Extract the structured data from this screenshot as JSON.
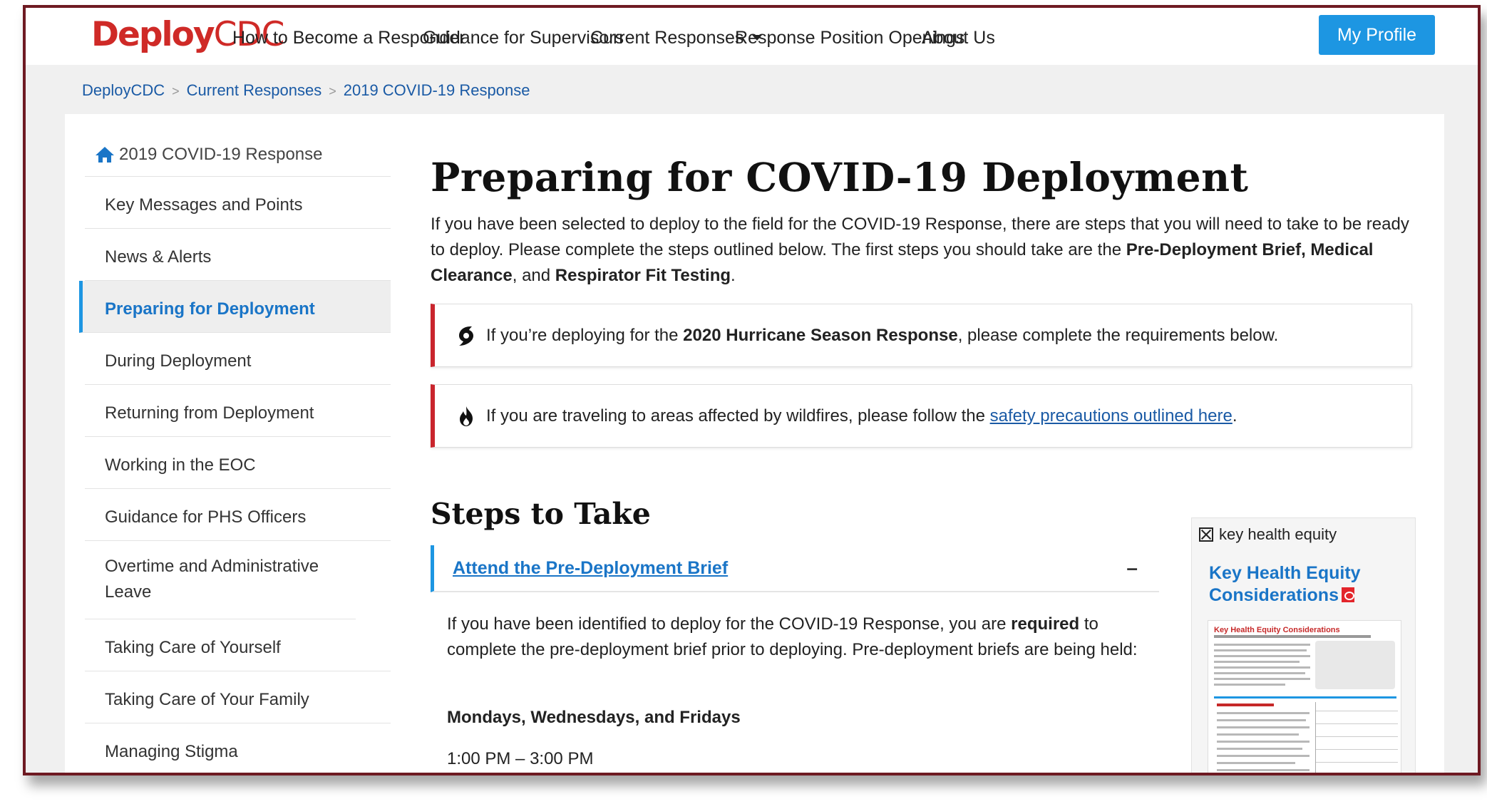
{
  "nav": {
    "logo_prefix": "Deploy",
    "logo_suffix": "CDC",
    "links": [
      "How to Become a Responder",
      "Guidance for Supervisors",
      "Current Responses",
      "Response Position Openings",
      "About Us"
    ],
    "profile_button": "My Profile"
  },
  "breadcrumb": [
    "DeployCDC",
    "Current Responses",
    "2019 COVID-19 Response"
  ],
  "breadcrumb_separator": ">",
  "sidebar": {
    "home": "2019 COVID-19 Response",
    "items": [
      "Key Messages and Points",
      "News & Alerts",
      "Preparing for Deployment",
      "During Deployment",
      "Returning from Deployment",
      "Working in the EOC",
      "Guidance for PHS Officers",
      "Overtime and Administrative Leave",
      "Taking Care of Yourself",
      "Taking Care of Your Family",
      "Managing Stigma"
    ],
    "active": "Preparing for Deployment"
  },
  "main": {
    "title": "Preparing for COVID-19 Deployment",
    "intro_1": "If you have been selected to deploy to the field for the COVID-19 Response, there are steps that you will need to take to be ready to deploy. Please complete the steps outlined below. The first steps you should take are the ",
    "intro_bold_1": "Pre-Deployment Brief, Medical Clearance",
    "intro_2": ", and ",
    "intro_bold_2": "Respirator Fit Testing",
    "intro_3": ".",
    "alert_hurricane": {
      "pre": "If you’re deploying for the ",
      "bold": "2020 Hurricane Season Response",
      "post": ", please complete the requirements below."
    },
    "alert_wildfire": {
      "pre": "If you are traveling to areas affected by wildfires, please follow the ",
      "link": "safety precautions outlined here",
      "post": "."
    },
    "steps_title": "Steps to Take",
    "accordion": {
      "title": "Attend the Pre-Deployment Brief",
      "toggle": "–",
      "body_pre": "If you have been identified to deploy for the COVID-19 Response, you are ",
      "body_bold": "required",
      "body_post": " to complete the pre-deployment brief prior to deploying. Pre-deployment briefs are being held:",
      "days": "Mondays, Wednesdays, and Fridays",
      "time": "1:00 PM – 3:00 PM"
    }
  },
  "side_widget": {
    "broken_image_alt": "key health equity",
    "title": "Key Health Equity Considerations",
    "thumb_title": "Key Health Equity Considerations"
  },
  "colors": {
    "brand_red": "#cf2a27",
    "primary_blue": "#1d96e2",
    "link_blue": "#1a75c7",
    "alert_red": "#c9252d",
    "frame": "#6e1a22"
  },
  "icons": [
    "home-icon",
    "caret-down-icon",
    "hurricane-icon",
    "fire-icon",
    "broken-image-icon",
    "pdf-icon"
  ]
}
